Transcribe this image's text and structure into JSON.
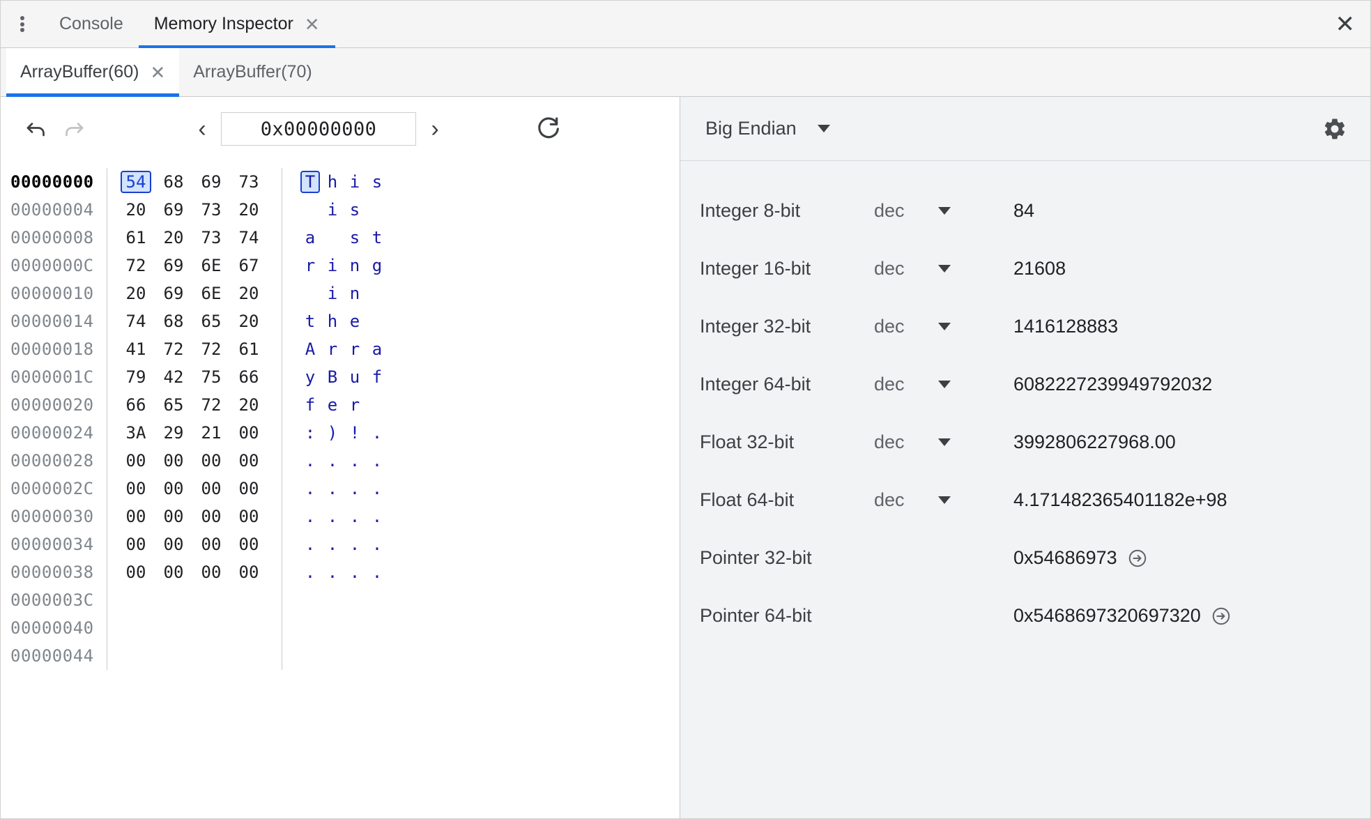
{
  "panel_tabs": {
    "menu_icon": "vertical-dots-icon",
    "items": [
      {
        "label": "Console",
        "active": false,
        "closable": false
      },
      {
        "label": "Memory Inspector",
        "active": true,
        "closable": true,
        "close_label": "✕"
      }
    ],
    "close_all_label": "✕"
  },
  "buffer_tabs": {
    "items": [
      {
        "label": "ArrayBuffer(60)",
        "active": true,
        "closable": true,
        "close_label": "✕"
      },
      {
        "label": "ArrayBuffer(70)",
        "active": false,
        "closable": false,
        "close_label": ""
      }
    ]
  },
  "memory_toolbar": {
    "undo_icon": "undo-icon",
    "redo_icon": "redo-icon",
    "prev_label": "‹",
    "next_label": "›",
    "address_value": "0x00000000",
    "address_placeholder": "0x00000000",
    "refresh_icon": "refresh-icon"
  },
  "hex_view": {
    "rows": [
      {
        "address": "00000000",
        "bytes": [
          "54",
          "68",
          "69",
          "73"
        ],
        "ascii": [
          "T",
          "h",
          "i",
          "s"
        ]
      },
      {
        "address": "00000004",
        "bytes": [
          "20",
          "69",
          "73",
          "20"
        ],
        "ascii": [
          " ",
          "i",
          "s",
          " "
        ]
      },
      {
        "address": "00000008",
        "bytes": [
          "61",
          "20",
          "73",
          "74"
        ],
        "ascii": [
          "a",
          " ",
          "s",
          "t"
        ]
      },
      {
        "address": "0000000C",
        "bytes": [
          "72",
          "69",
          "6E",
          "67"
        ],
        "ascii": [
          "r",
          "i",
          "n",
          "g"
        ]
      },
      {
        "address": "00000010",
        "bytes": [
          "20",
          "69",
          "6E",
          "20"
        ],
        "ascii": [
          " ",
          "i",
          "n",
          " "
        ]
      },
      {
        "address": "00000014",
        "bytes": [
          "74",
          "68",
          "65",
          "20"
        ],
        "ascii": [
          "t",
          "h",
          "e",
          " "
        ]
      },
      {
        "address": "00000018",
        "bytes": [
          "41",
          "72",
          "72",
          "61"
        ],
        "ascii": [
          "A",
          "r",
          "r",
          "a"
        ]
      },
      {
        "address": "0000001C",
        "bytes": [
          "79",
          "42",
          "75",
          "66"
        ],
        "ascii": [
          "y",
          "B",
          "u",
          "f"
        ]
      },
      {
        "address": "00000020",
        "bytes": [
          "66",
          "65",
          "72",
          "20"
        ],
        "ascii": [
          "f",
          "e",
          "r",
          " "
        ]
      },
      {
        "address": "00000024",
        "bytes": [
          "3A",
          "29",
          "21",
          "00"
        ],
        "ascii": [
          ":",
          ")",
          "!",
          "."
        ]
      },
      {
        "address": "00000028",
        "bytes": [
          "00",
          "00",
          "00",
          "00"
        ],
        "ascii": [
          ".",
          ".",
          ".",
          "."
        ]
      },
      {
        "address": "0000002C",
        "bytes": [
          "00",
          "00",
          "00",
          "00"
        ],
        "ascii": [
          ".",
          ".",
          ".",
          "."
        ]
      },
      {
        "address": "00000030",
        "bytes": [
          "00",
          "00",
          "00",
          "00"
        ],
        "ascii": [
          ".",
          ".",
          ".",
          "."
        ]
      },
      {
        "address": "00000034",
        "bytes": [
          "00",
          "00",
          "00",
          "00"
        ],
        "ascii": [
          ".",
          ".",
          ".",
          "."
        ]
      },
      {
        "address": "00000038",
        "bytes": [
          "00",
          "00",
          "00",
          "00"
        ],
        "ascii": [
          ".",
          ".",
          ".",
          "."
        ]
      },
      {
        "address": "0000003C",
        "bytes": [],
        "ascii": []
      },
      {
        "address": "00000040",
        "bytes": [],
        "ascii": []
      },
      {
        "address": "00000044",
        "bytes": [],
        "ascii": []
      }
    ],
    "selected_row": 0,
    "selected_col": 0,
    "selected_byte": "54",
    "selected_char": "T"
  },
  "value_inspector": {
    "endianness": "Big Endian",
    "settings_icon": "gear-icon",
    "rows": [
      {
        "type": "Integer 8-bit",
        "mode": "dec",
        "value": "84",
        "has_jump": false
      },
      {
        "type": "Integer 16-bit",
        "mode": "dec",
        "value": "21608",
        "has_jump": false
      },
      {
        "type": "Integer 32-bit",
        "mode": "dec",
        "value": "1416128883",
        "has_jump": false
      },
      {
        "type": "Integer 64-bit",
        "mode": "dec",
        "value": "6082227239949792032",
        "has_jump": false
      },
      {
        "type": "Float 32-bit",
        "mode": "dec",
        "value": "3992806227968.00",
        "has_jump": false
      },
      {
        "type": "Float 64-bit",
        "mode": "dec",
        "value": "4.171482365401182e+98",
        "has_jump": false
      },
      {
        "type": "Pointer 32-bit",
        "mode": "",
        "value": "0x54686973",
        "has_jump": true
      },
      {
        "type": "Pointer 64-bit",
        "mode": "",
        "value": "0x5468697320697320",
        "has_jump": true
      }
    ]
  },
  "colors": {
    "accent": "#1a73e8",
    "selection_bg": "#d2e3fc",
    "selection_border": "#1a3fd0",
    "ascii_text": "#1a1aa8",
    "panel_bg": "#f1f3f4",
    "toolbar_bg": "#f5f5f5"
  }
}
